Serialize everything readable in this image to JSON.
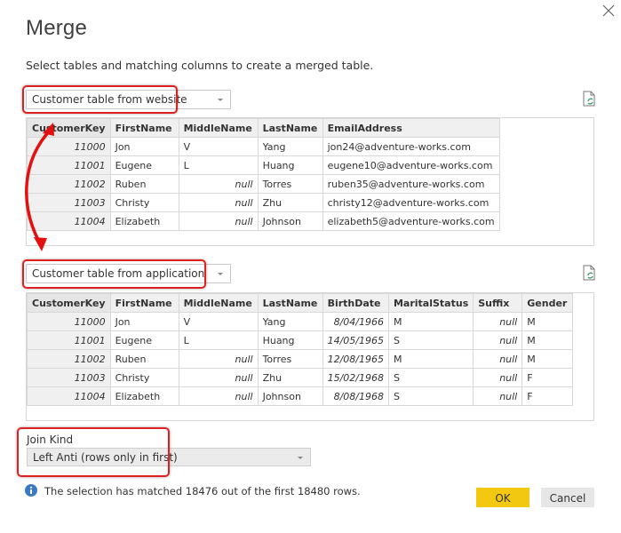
{
  "dialog": {
    "title": "Merge",
    "subtitle": "Select tables and matching columns to create a merged table.",
    "close_icon": "close-x"
  },
  "table1": {
    "selected": "Customer table from website",
    "columns": [
      "CustomerKey",
      "FirstName",
      "MiddleName",
      "LastName",
      "EmailAddress"
    ],
    "rows": [
      [
        "11000",
        "Jon",
        "V",
        "Yang",
        "jon24@adventure-works.com"
      ],
      [
        "11001",
        "Eugene",
        "L",
        "Huang",
        "eugene10@adventure-works.com"
      ],
      [
        "11002",
        "Ruben",
        "null",
        "Torres",
        "ruben35@adventure-works.com"
      ],
      [
        "11003",
        "Christy",
        "null",
        "Zhu",
        "christy12@adventure-works.com"
      ],
      [
        "11004",
        "Elizabeth",
        "null",
        "Johnson",
        "elizabeth5@adventure-works.com"
      ]
    ]
  },
  "table2": {
    "selected": "Customer table from application",
    "columns": [
      "CustomerKey",
      "FirstName",
      "MiddleName",
      "LastName",
      "BirthDate",
      "MaritalStatus",
      "Suffix",
      "Gender"
    ],
    "rows": [
      [
        "11000",
        "Jon",
        "V",
        "Yang",
        "8/04/1966",
        "M",
        "null",
        "M"
      ],
      [
        "11001",
        "Eugene",
        "L",
        "Huang",
        "14/05/1965",
        "S",
        "null",
        "M"
      ],
      [
        "11002",
        "Ruben",
        "null",
        "Torres",
        "12/08/1965",
        "M",
        "null",
        "M"
      ],
      [
        "11003",
        "Christy",
        "null",
        "Zhu",
        "15/02/1968",
        "S",
        "null",
        "F"
      ],
      [
        "11004",
        "Elizabeth",
        "null",
        "Johnson",
        "8/08/1968",
        "S",
        "null",
        "F"
      ]
    ]
  },
  "join": {
    "label": "Join Kind",
    "selected": "Left Anti (rows only in first)"
  },
  "status": {
    "icon": "info-icon",
    "text": "The selection has matched 18476 out of the first 18480 rows."
  },
  "buttons": {
    "ok": "OK",
    "cancel": "Cancel"
  },
  "colors": {
    "ok_button": "#f2c811",
    "cancel_button": "#e6e6e6",
    "annotation_red": "#e02020",
    "info_blue": "#3a7abf"
  }
}
